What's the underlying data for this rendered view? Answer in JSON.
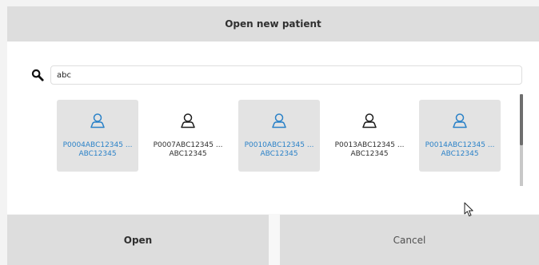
{
  "dialog": {
    "title": "Open new patient"
  },
  "search": {
    "value": "abc",
    "icon": "search-icon"
  },
  "patients": [
    {
      "line1": "P0004ABC12345 ...",
      "line2": "ABC12345",
      "selected": true
    },
    {
      "line1": "P0007ABC12345 ...",
      "line2": "ABC12345",
      "selected": false
    },
    {
      "line1": "P0010ABC12345 ...",
      "line2": "ABC12345",
      "selected": true
    },
    {
      "line1": "P0013ABC12345 ...",
      "line2": "ABC12345",
      "selected": false
    },
    {
      "line1": "P0014ABC12345 ...",
      "line2": "ABC12345",
      "selected": true
    }
  ],
  "buttons": {
    "open": "Open",
    "cancel": "Cancel"
  },
  "colors": {
    "accent": "#2b82c8",
    "header_bg": "#dddddd",
    "selected_tile_bg": "#e3e3e3"
  }
}
